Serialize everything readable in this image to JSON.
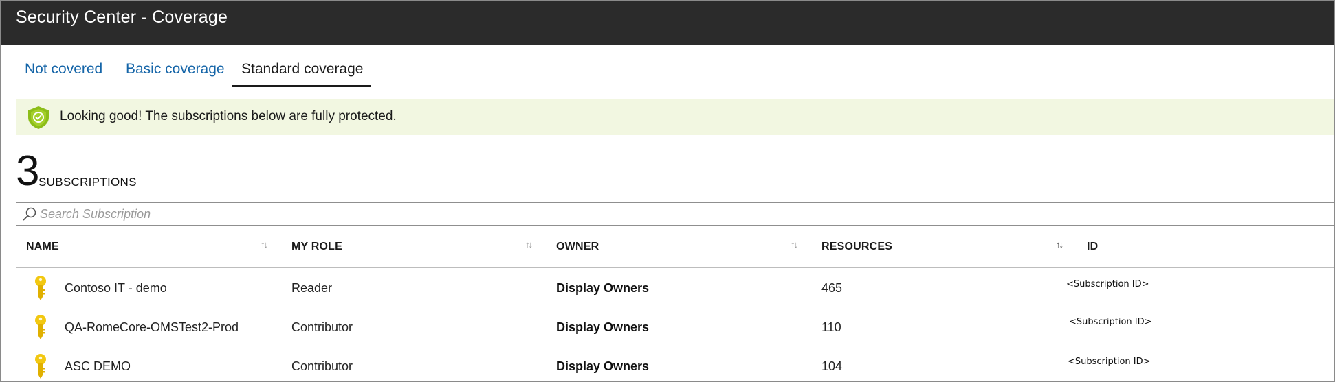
{
  "window": {
    "title": "Security Center - Coverage"
  },
  "tabs": [
    {
      "label": "Not covered"
    },
    {
      "label": "Basic coverage"
    },
    {
      "label": "Standard coverage",
      "selected": true
    }
  ],
  "banner": {
    "message": "Looking good! The subscriptions below are fully protected.",
    "icon": "shield-check-icon",
    "color": "#8cbd18"
  },
  "summary": {
    "count": "3",
    "label": "SUBSCRIPTIONS"
  },
  "search": {
    "placeholder": "Search Subscription",
    "value": ""
  },
  "table": {
    "columns": [
      {
        "label": "NAME",
        "sort": "↑↓"
      },
      {
        "label": "MY ROLE",
        "sort": "↑↓"
      },
      {
        "label": "OWNER",
        "sort": "↑↓"
      },
      {
        "label": "RESOURCES",
        "sort": "↑↓"
      },
      {
        "label": "ID"
      }
    ],
    "rows": [
      {
        "name": "Contoso IT - demo",
        "role": "Reader",
        "owner": "Display Owners",
        "resources": "465",
        "id": "<Subscription ID>",
        "icon": "key-icon"
      },
      {
        "name": "QA-RomeCore-OMSTest2-Prod",
        "role": "Contributor",
        "owner": "Display Owners",
        "resources": "110",
        "id": "<Subscription ID>",
        "icon": "key-icon"
      },
      {
        "name": "ASC DEMO",
        "role": "Contributor",
        "owner": "Display Owners",
        "resources": "104",
        "id": "<Subscription ID>",
        "icon": "key-icon"
      }
    ]
  },
  "colors": {
    "titlebar": "#2b2b2b",
    "link": "#1565a8",
    "banner_bg": "#f2f7e1",
    "key": "#f2c811"
  }
}
